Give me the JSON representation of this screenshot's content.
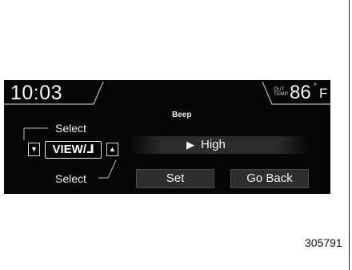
{
  "clock": {
    "time": "10:03"
  },
  "out_temp": {
    "label_line1": "OUT",
    "label_line2": "TEMP",
    "value": "86",
    "degree": "°",
    "unit": "F"
  },
  "screen": {
    "title": "Beep",
    "selected_value": "High",
    "value_indicator_icon": "play-triangle-icon"
  },
  "controls": {
    "select_top_label": "Select",
    "select_bottom_label": "Select",
    "view_button_label": "VIEW/⅃",
    "down_arrow": "▼",
    "up_arrow": "▲"
  },
  "buttons": {
    "set": "Set",
    "go_back": "Go Back"
  },
  "figure_code": "305791",
  "colors": {
    "display_bg": "#060606",
    "text": "#f2f2f2",
    "button_bg": "#2e2e2e"
  }
}
